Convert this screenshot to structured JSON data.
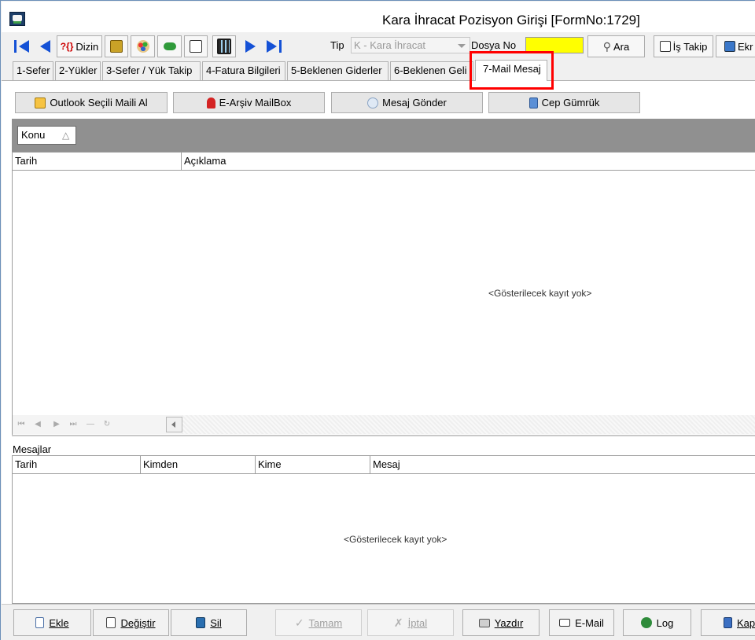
{
  "window": {
    "title": "Kara İhracat Pozisyon Girişi [FormNo:1729]"
  },
  "toolbar": {
    "dizin_label": "Dizin",
    "dizin_prefix": "?{}",
    "tip_label": "Tip",
    "tip_value": "K - Kara  İhracat",
    "dosya_label": "Dosya No",
    "dosya_value": "",
    "ara_label": "Ara",
    "is_takip_label": "İş Takip",
    "ekran_label": "Ekr"
  },
  "tabs": [
    {
      "label": "1-Sefer"
    },
    {
      "label": "2-Yükler"
    },
    {
      "label": "3-Sefer / Yük Takip"
    },
    {
      "label": "4-Fatura Bilgileri"
    },
    {
      "label": "5-Beklenen Giderler"
    },
    {
      "label": "6-Beklenen Geli"
    },
    {
      "label": "7-Mail Mesaj"
    }
  ],
  "actions": {
    "outlook": "Outlook Seçili Maili Al",
    "earsiv": "E-Arşiv MailBox",
    "mesaj_gonder": "Mesaj Gönder",
    "cep_gumruk": "Cep Gümrük"
  },
  "grid1": {
    "group_by": "Konu",
    "group_sort_glyph": "△",
    "columns": [
      "Tarih",
      "Açıklama"
    ],
    "empty_text": "<Gösterilecek kayıt yok>"
  },
  "grid2": {
    "section_label": "Mesajlar",
    "columns": [
      "Tarih",
      "Kimden",
      "Kime",
      "Mesaj"
    ],
    "empty_text": "<Gösterilecek kayıt yok>"
  },
  "bottom": {
    "ekle": "Ekle",
    "degistir": "Değiştir",
    "sil": "Sil",
    "tamam": "Tamam",
    "iptal": "İptal",
    "yazdir": "Yazdır",
    "email": "E-Mail",
    "log": "Log",
    "kapat": "Kap"
  },
  "colors": {
    "accent_nav": "#1451d6",
    "dosya_highlight": "#ffff00",
    "annotation": "#ff0000"
  }
}
